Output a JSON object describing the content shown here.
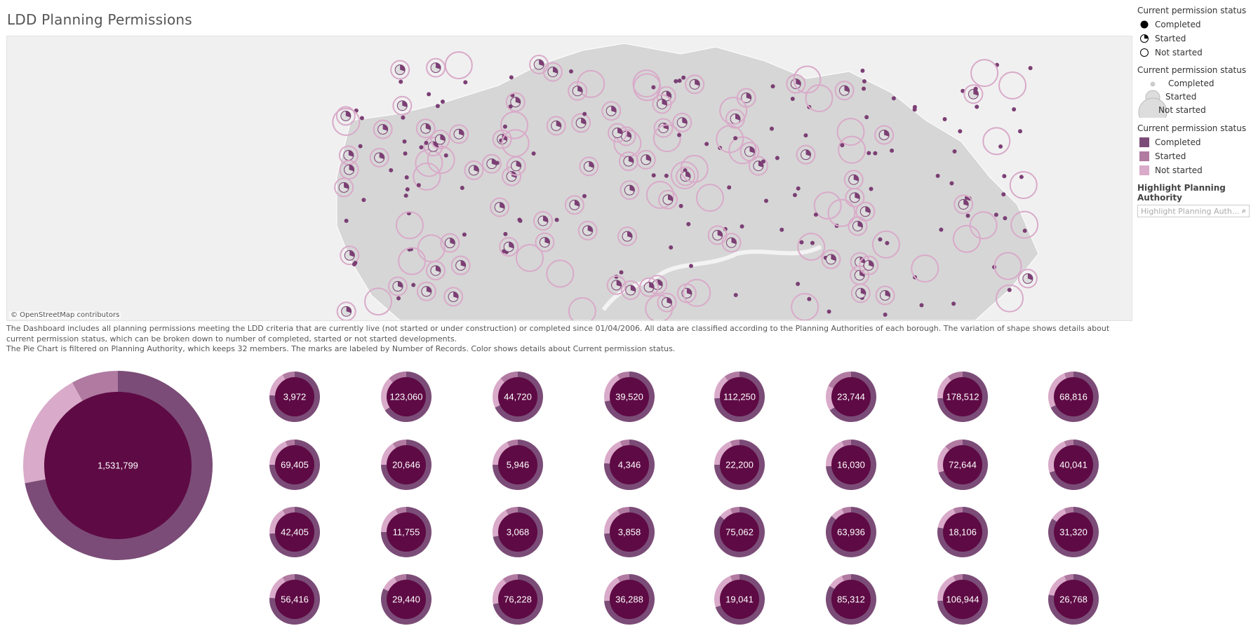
{
  "title": "LDD Planning Permissions",
  "map": {
    "attribution": "© OpenStreetMap contributors"
  },
  "description": {
    "line1": "The Dashboard includes all planning permissions meeting the LDD criteria that are currently live (not started or under construction) or completed since 01/04/2006. All data are classified according to the Planning Authorities of each borough. The variation of  shape shows details about current permission status, which can be broken down to number of completed, started or not started developments.",
    "line2": "The Pie Chart is filtered on Planning Authority, which keeps 32 members.  The marks are labeled by Number of Records. Color shows details about Current permission status."
  },
  "legend": {
    "shape": {
      "title": "Current permission status",
      "items": [
        {
          "label": "Completed",
          "icon": "filled-circle-icon"
        },
        {
          "label": "Started",
          "icon": "partial-circle-icon"
        },
        {
          "label": "Not started",
          "icon": "empty-circle-icon"
        }
      ]
    },
    "size": {
      "title": "Current permission status",
      "items": [
        {
          "label": "Completed"
        },
        {
          "label": "Started"
        },
        {
          "label": "Not started"
        }
      ]
    },
    "color": {
      "title": "Current permission status",
      "items": [
        {
          "label": "Completed",
          "color": "#7b4c77"
        },
        {
          "label": "Started",
          "color": "#b07aa1"
        },
        {
          "label": "Not started",
          "color": "#d9aac9"
        }
      ]
    },
    "highlight": {
      "title": "Highlight Planning Authority",
      "placeholder": "Highlight Planning Auth..."
    }
  },
  "colors": {
    "completed": "#7b4c77",
    "started": "#b07aa1",
    "not_started": "#d9aac9",
    "center": "#5e0a44",
    "map_land": "#d6d6d6",
    "map_bg": "#f0f0f0"
  },
  "chart_data": {
    "type": "pie",
    "total": {
      "label": "1,531,799",
      "shares": {
        "completed": 0.72,
        "not_started": 0.2,
        "started": 0.08
      }
    },
    "authorities": [
      {
        "label": "3,972",
        "completed": 0.76,
        "not_started": 0.16,
        "started": 0.08
      },
      {
        "label": "123,060",
        "completed": 0.66,
        "not_started": 0.22,
        "started": 0.12
      },
      {
        "label": "44,720",
        "completed": 0.68,
        "not_started": 0.2,
        "started": 0.12
      },
      {
        "label": "39,520",
        "completed": 0.72,
        "not_started": 0.2,
        "started": 0.08
      },
      {
        "label": "112,250",
        "completed": 0.74,
        "not_started": 0.16,
        "started": 0.1
      },
      {
        "label": "23,744",
        "completed": 0.66,
        "not_started": 0.16,
        "started": 0.18
      },
      {
        "label": "178,512",
        "completed": 0.74,
        "not_started": 0.16,
        "started": 0.1
      },
      {
        "label": "68,816",
        "completed": 0.68,
        "not_started": 0.26,
        "started": 0.06
      },
      {
        "label": "69,405",
        "completed": 0.75,
        "not_started": 0.19,
        "started": 0.06
      },
      {
        "label": "20,646",
        "completed": 0.75,
        "not_started": 0.16,
        "started": 0.09
      },
      {
        "label": "5,946",
        "completed": 0.75,
        "not_started": 0.18,
        "started": 0.07
      },
      {
        "label": "4,346",
        "completed": 0.76,
        "not_started": 0.18,
        "started": 0.06
      },
      {
        "label": "22,200",
        "completed": 0.75,
        "not_started": 0.19,
        "started": 0.06
      },
      {
        "label": "16,030",
        "completed": 0.74,
        "not_started": 0.2,
        "started": 0.06
      },
      {
        "label": "72,644",
        "completed": 0.7,
        "not_started": 0.18,
        "started": 0.12
      },
      {
        "label": "40,041",
        "completed": 0.7,
        "not_started": 0.24,
        "started": 0.06
      },
      {
        "label": "42,405",
        "completed": 0.74,
        "not_started": 0.18,
        "started": 0.08
      },
      {
        "label": "11,755",
        "completed": 0.75,
        "not_started": 0.18,
        "started": 0.07
      },
      {
        "label": "3,068",
        "completed": 0.72,
        "not_started": 0.2,
        "started": 0.08
      },
      {
        "label": "3,858",
        "completed": 0.74,
        "not_started": 0.18,
        "started": 0.08
      },
      {
        "label": "75,062",
        "completed": 0.86,
        "not_started": 0.08,
        "started": 0.06
      },
      {
        "label": "63,936",
        "completed": 0.86,
        "not_started": 0.08,
        "started": 0.06
      },
      {
        "label": "18,106",
        "completed": 0.78,
        "not_started": 0.16,
        "started": 0.06
      },
      {
        "label": "31,320",
        "completed": 0.84,
        "not_started": 0.1,
        "started": 0.06
      },
      {
        "label": "56,416",
        "completed": 0.76,
        "not_started": 0.16,
        "started": 0.08
      },
      {
        "label": "29,440",
        "completed": 0.82,
        "not_started": 0.1,
        "started": 0.08
      },
      {
        "label": "76,228",
        "completed": 0.72,
        "not_started": 0.18,
        "started": 0.1
      },
      {
        "label": "36,288",
        "completed": 0.74,
        "not_started": 0.18,
        "started": 0.08
      },
      {
        "label": "19,041",
        "completed": 0.7,
        "not_started": 0.24,
        "started": 0.06
      },
      {
        "label": "85,312",
        "completed": 0.84,
        "not_started": 0.1,
        "started": 0.06
      },
      {
        "label": "106,944",
        "completed": 0.74,
        "not_started": 0.2,
        "started": 0.06
      },
      {
        "label": "26,768",
        "completed": 0.78,
        "not_started": 0.16,
        "started": 0.06
      }
    ]
  }
}
